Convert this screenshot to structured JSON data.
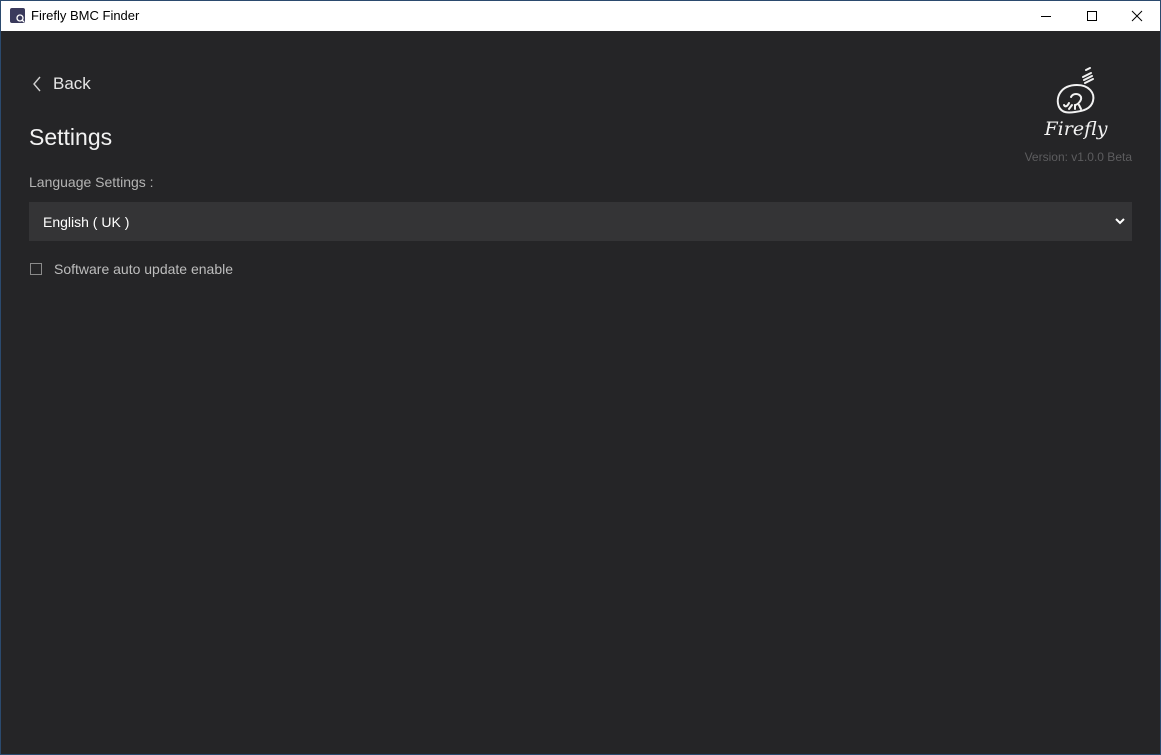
{
  "window": {
    "title": "Firefly BMC Finder",
    "icon": "app-icon"
  },
  "nav": {
    "back_label": "Back"
  },
  "page": {
    "title": "Settings"
  },
  "language": {
    "label": "Language Settings :",
    "selected": "English ( UK )"
  },
  "auto_update": {
    "label": "Software auto update enable",
    "checked": false
  },
  "brand": {
    "logo_text": "Firefly",
    "version": "Version: v1.0.0 Beta"
  },
  "colors": {
    "background": "#252527",
    "select_background": "#343436",
    "titlebar": "#ffffff",
    "accent_border": "#2b4a6e"
  }
}
